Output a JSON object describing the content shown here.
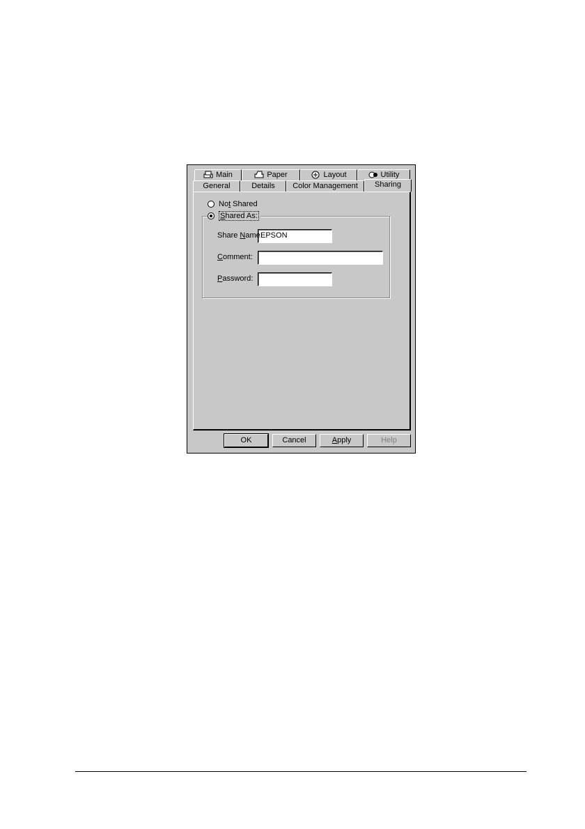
{
  "tabs_row_back": [
    {
      "label": "Main",
      "icon": "printer-icon"
    },
    {
      "label": "Paper",
      "icon": "paper-icon"
    },
    {
      "label": "Layout",
      "icon": "layout-icon"
    },
    {
      "label": "Utility",
      "icon": "utility-icon"
    }
  ],
  "tabs_row_front": [
    {
      "label": "General"
    },
    {
      "label": "Details"
    },
    {
      "label": "Color Management"
    },
    {
      "label": "Sharing"
    }
  ],
  "active_tab": "Sharing",
  "sharing": {
    "not_shared_pre": "No",
    "not_shared_u": "t",
    "not_shared_post": " Shared",
    "not_shared_checked": false,
    "shared_as_pre": "",
    "shared_as_u": "S",
    "shared_as_post": "hared As:",
    "shared_as_checked": true,
    "share_name_label_pre": "Share ",
    "share_name_label_u": "N",
    "share_name_label_post": "ame:",
    "share_name_value": "EPSON",
    "comment_label_u": "C",
    "comment_label_post": "omment:",
    "comment_value": "",
    "password_label_u": "P",
    "password_label_post": "assword:",
    "password_value": ""
  },
  "buttons": {
    "ok": "OK",
    "cancel": "Cancel",
    "apply_u": "A",
    "apply_post": "pply",
    "help": "Help"
  }
}
